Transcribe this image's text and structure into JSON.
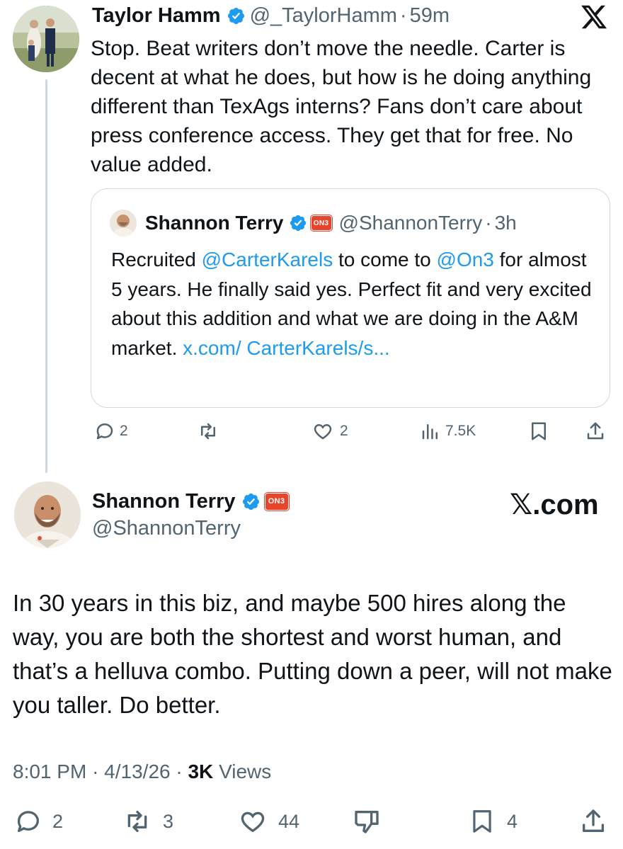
{
  "reply_tweet": {
    "author_name": "Taylor Hamm",
    "handle": "@_TaylorHamm",
    "separator": "·",
    "time": "59m",
    "text": "Stop. Beat writers don’t move the needle. Carter is decent at what he does, but how is he doing anything different than TexAgs interns? Fans don’t care about press conference access. They get that for free. No value added.",
    "quoted": {
      "author_name": "Shannon Terry",
      "badge": "ON3",
      "handle": "@ShannonTerry",
      "separator": "·",
      "time": "3h",
      "text_parts": {
        "t1": "Recruited ",
        "mention1": "@CarterKarels",
        "t2": " to come to ",
        "mention2": "@On3",
        "t3": " for almost 5 years. He finally said yes. Perfect fit and very excited about this addition and what we are doing in the A&M market. ",
        "link": "x.com/ CarterKarels/s..."
      }
    },
    "actions": {
      "replies": "2",
      "likes": "2",
      "views": "7.5K"
    }
  },
  "main_tweet": {
    "author_name": "Shannon Terry",
    "badge": "ON3",
    "handle": "@ShannonTerry",
    "watermark": "X.com",
    "watermark_x": "𝕏",
    "watermark_suffix": ".com",
    "text": "In 30 years in this biz, and maybe 500 hires along the way, you are both the shortest and worst human, and that’s a helluva combo. Putting down a peer, will not make you taller. Do better.",
    "time": "8:01 PM",
    "date": "4/13/26",
    "meta_sep": "·",
    "views_count": "3K",
    "views_label": "Views",
    "actions": {
      "replies": "2",
      "reposts": "3",
      "likes": "44",
      "bookmarks": "4"
    }
  },
  "colors": {
    "text": "#0f1419",
    "secondary": "#536471",
    "link": "#1d9bf0",
    "verified": "#1d9bf0",
    "border": "#cfd9de",
    "on3_badge": "#e8442c"
  },
  "icons": [
    "x-logo-icon",
    "verified-badge-icon",
    "on3-badge",
    "reply-icon",
    "repost-icon",
    "like-icon",
    "views-icon",
    "bookmark-icon",
    "share-icon",
    "dislike-icon"
  ]
}
